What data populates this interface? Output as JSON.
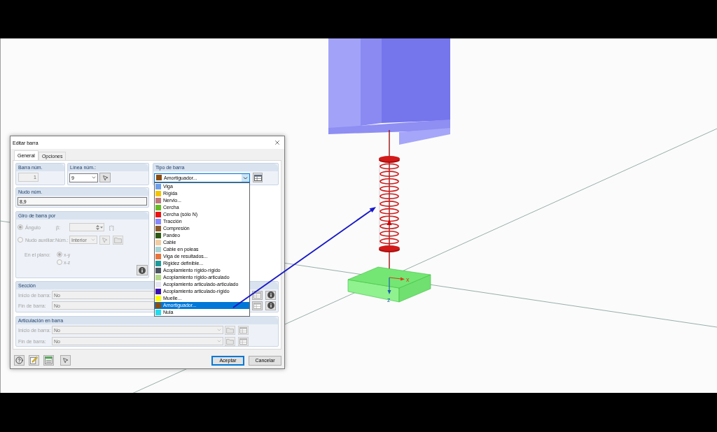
{
  "dialog": {
    "title": "Editar barra",
    "tabs": [
      {
        "label": "General",
        "selected": true
      },
      {
        "label": "Opciones",
        "selected": false
      }
    ],
    "member_no": {
      "title": "Barra núm.",
      "value": "1"
    },
    "line_no": {
      "title": "Línea núm.:",
      "value": "9"
    },
    "member_type": {
      "title": "Tipo de barra",
      "value": "Amortiguador...",
      "expanded": true,
      "options": [
        {
          "label": "Viga",
          "color": "#6d9eeb",
          "selected": false
        },
        {
          "label": "Rígida",
          "color": "#f5c400",
          "selected": false
        },
        {
          "label": "Nervio...",
          "color": "#c0777c",
          "selected": false
        },
        {
          "label": "Cercha",
          "color": "#66bb22",
          "selected": false
        },
        {
          "label": "Cercha (sólo N)",
          "color": "#ee1111",
          "selected": false
        },
        {
          "label": "Tracción",
          "color": "#8888ff",
          "selected": false
        },
        {
          "label": "Compresión",
          "color": "#8b5a2b",
          "selected": false
        },
        {
          "label": "Pandeo",
          "color": "#2d5a12",
          "selected": false
        },
        {
          "label": "Cable",
          "color": "#f2cda4",
          "selected": false
        },
        {
          "label": "Cable en poleas",
          "color": "#a6d5d5",
          "selected": false
        },
        {
          "label": "Viga de resultados...",
          "color": "#e8743b",
          "selected": false
        },
        {
          "label": "Rigidez definible...",
          "color": "#1f9a9a",
          "selected": false
        },
        {
          "label": "Acoplamiento rígido-rígido",
          "color": "#4d5560",
          "selected": false
        },
        {
          "label": "Acoplamiento rígido-articulado",
          "color": "#b5d88a",
          "selected": false
        },
        {
          "label": "Acoplamiento articulado-articulado",
          "color": "#e6e6f2",
          "selected": false
        },
        {
          "label": "Acoplamiento articulado-rígido",
          "color": "#3a0fb0",
          "selected": false
        },
        {
          "label": "Muelle...",
          "color": "#ffff00",
          "selected": false
        },
        {
          "label": "Amortiguador...",
          "color": "#8b4c10",
          "selected": true
        },
        {
          "label": "Nula",
          "color": "#22dcef",
          "selected": false
        }
      ]
    },
    "node_no": {
      "title": "Nudo núm.",
      "value": "8,9"
    },
    "rotation": {
      "title": "Giro de barra por",
      "disabled": true,
      "modes": [
        {
          "kind": "angle",
          "label": "Ángulo",
          "selected": true,
          "symbol": "β:",
          "unit": "[°]"
        },
        {
          "kind": "node",
          "label": "Nudo auxiliar:",
          "selected": false,
          "number_label": "Núm.:",
          "value": "Interior"
        }
      ],
      "plane": {
        "label": "En el plano:",
        "options": [
          {
            "label": "x-y",
            "selected": true
          },
          {
            "label": "x-z",
            "selected": false
          }
        ]
      }
    },
    "section": {
      "title": "Sección",
      "disabled": true,
      "rows": [
        {
          "label": "Inicio de barra:",
          "value": "No"
        },
        {
          "label": "Fin de barra:",
          "value": "No"
        }
      ]
    },
    "hinge": {
      "title": "Articulación en barra",
      "disabled": true,
      "rows": [
        {
          "label": "Inicio de barra:",
          "value": "No"
        },
        {
          "label": "Fin de barra:",
          "value": "No"
        }
      ]
    },
    "buttons": [
      {
        "label": "Aceptar",
        "default": true
      },
      {
        "label": "Cancelar",
        "default": false
      }
    ]
  },
  "viewport": {
    "axes": [
      {
        "label": "x"
      },
      {
        "label": "z"
      }
    ]
  }
}
